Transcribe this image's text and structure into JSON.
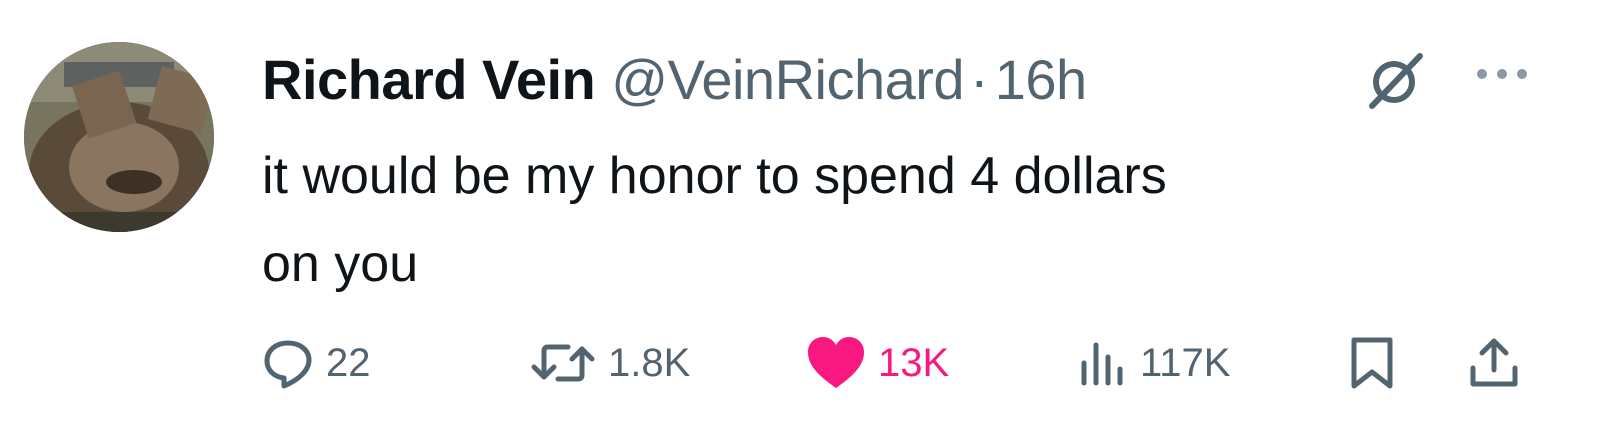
{
  "tweet": {
    "author": {
      "display_name": "Richard Vein",
      "handle": "@VeinRichard"
    },
    "separator": "·",
    "timestamp": "16h",
    "text_line_1": "it would be my honor to spend 4 dollars",
    "text_line_2": "on you",
    "metrics": {
      "replies": "22",
      "reposts": "1.8K",
      "likes": "13K",
      "views": "117K"
    },
    "liked": true
  },
  "colors": {
    "primary_text": "#0f1419",
    "secondary_text": "#536471",
    "like_pink": "#f91880"
  },
  "icons": {
    "grok": "grok-icon",
    "more": "more-icon",
    "reply": "reply-icon",
    "repost": "repost-icon",
    "like": "heart-icon",
    "views": "views-icon",
    "bookmark": "bookmark-icon",
    "share": "share-icon"
  }
}
